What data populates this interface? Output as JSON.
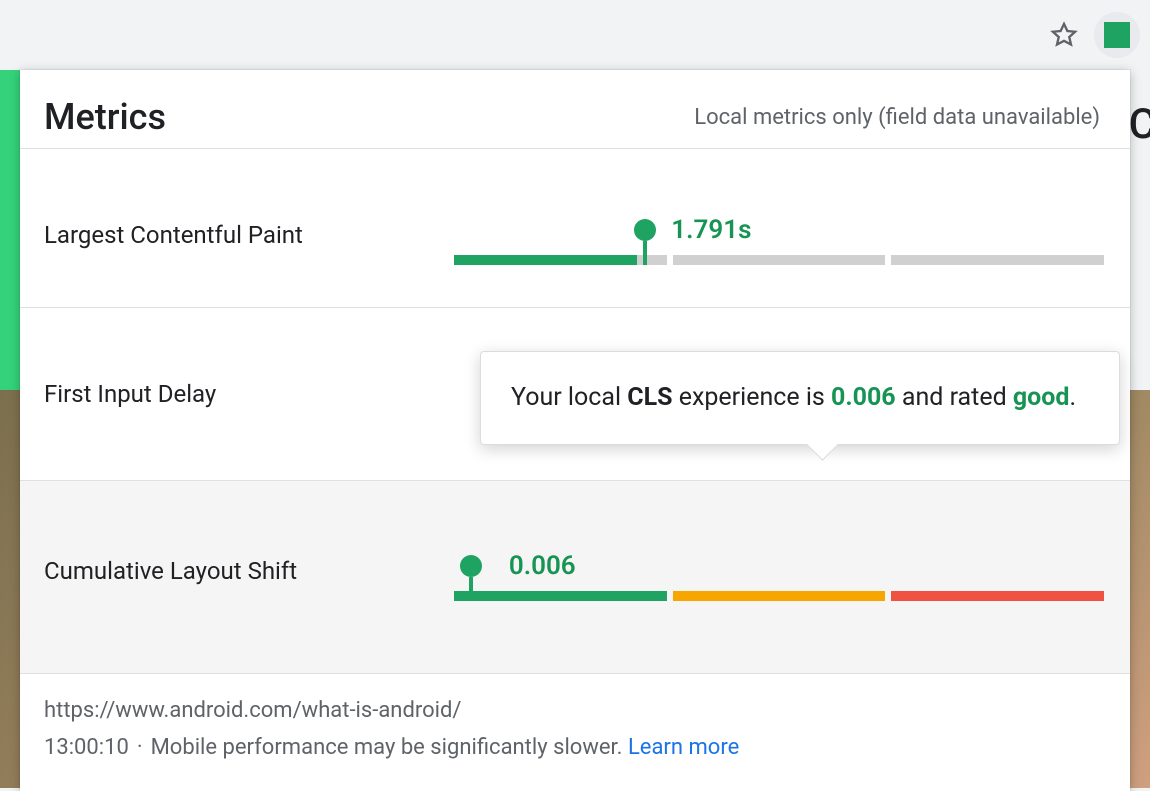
{
  "browser": {
    "star_icon": "star-icon",
    "extension_badge_color": "#1ea362"
  },
  "panel": {
    "title": "Metrics",
    "subtitle": "Local metrics only (field data unavailable)"
  },
  "metrics": [
    {
      "label": "Largest Contentful Paint",
      "value": "1.791s",
      "marker_position_pct": 28,
      "segments": [
        "green-partial:86",
        "gray",
        "gray"
      ]
    },
    {
      "label": "First Input Delay",
      "value": "",
      "marker_position_pct": null,
      "segments": []
    },
    {
      "label": "Cumulative Layout Shift",
      "value": "0.006",
      "marker_position_pct": 2.2,
      "segments": [
        "green-filled",
        "orange",
        "red"
      ]
    }
  ],
  "tooltip": {
    "prefix": "Your local ",
    "metric_abbrev": "CLS",
    "mid": " experience is ",
    "value": "0.006",
    "mid2": " and rated ",
    "rating": "good",
    "suffix": "."
  },
  "footer": {
    "url": "https://www.android.com/what-is-android/",
    "time": "13:00:10",
    "note": "Mobile performance may be significantly slower.",
    "link": "Learn more"
  }
}
